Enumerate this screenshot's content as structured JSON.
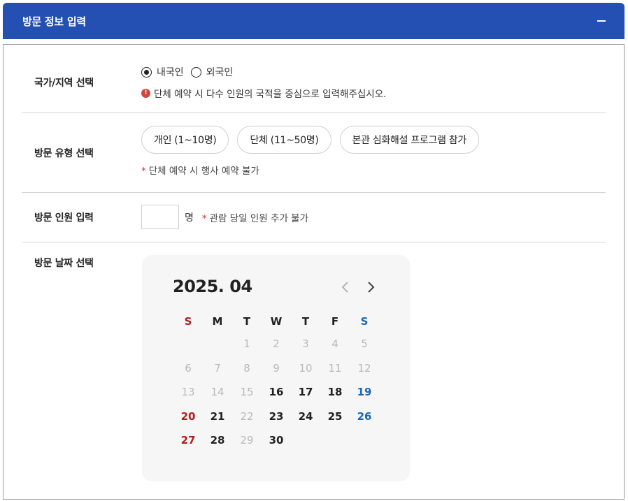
{
  "header": {
    "title": "방문 정보 입력",
    "collapse_icon": "minus-icon"
  },
  "nationality": {
    "label": "국가/지역 선택",
    "options": [
      {
        "label": "내국인",
        "checked": true
      },
      {
        "label": "외국인",
        "checked": false
      }
    ],
    "notice": "단체 예약 시 다수 인원의 국적을 중심으로 입력해주십시오."
  },
  "visit_type": {
    "label": "방문 유형 선택",
    "options": [
      "개인 (1~10명)",
      "단체 (11~50명)",
      "본관 심화해설 프로그램 참가"
    ],
    "note": "단체 예약 시 행사 예약 불가"
  },
  "visitors": {
    "label": "방문 인원 입력",
    "value": "",
    "unit": "명",
    "note": "관람 당일 인원 추가 불가"
  },
  "visit_date": {
    "label": "방문 날짜 선택",
    "calendar": {
      "title": "2025. 04",
      "weekdays": [
        "S",
        "M",
        "T",
        "W",
        "T",
        "F",
        "S"
      ],
      "first_weekday": 2,
      "days_in_month": 30,
      "first_available_day": 16,
      "disabled_days": [
        22,
        29
      ],
      "colors": {
        "sunday": "#b31c1c",
        "saturday": "#1c66b3",
        "disabled": "#b9b9b9"
      }
    }
  },
  "colors": {
    "header_bg": "#2450b3",
    "required_star": "#d9312b",
    "info_icon": "#d0463b"
  }
}
